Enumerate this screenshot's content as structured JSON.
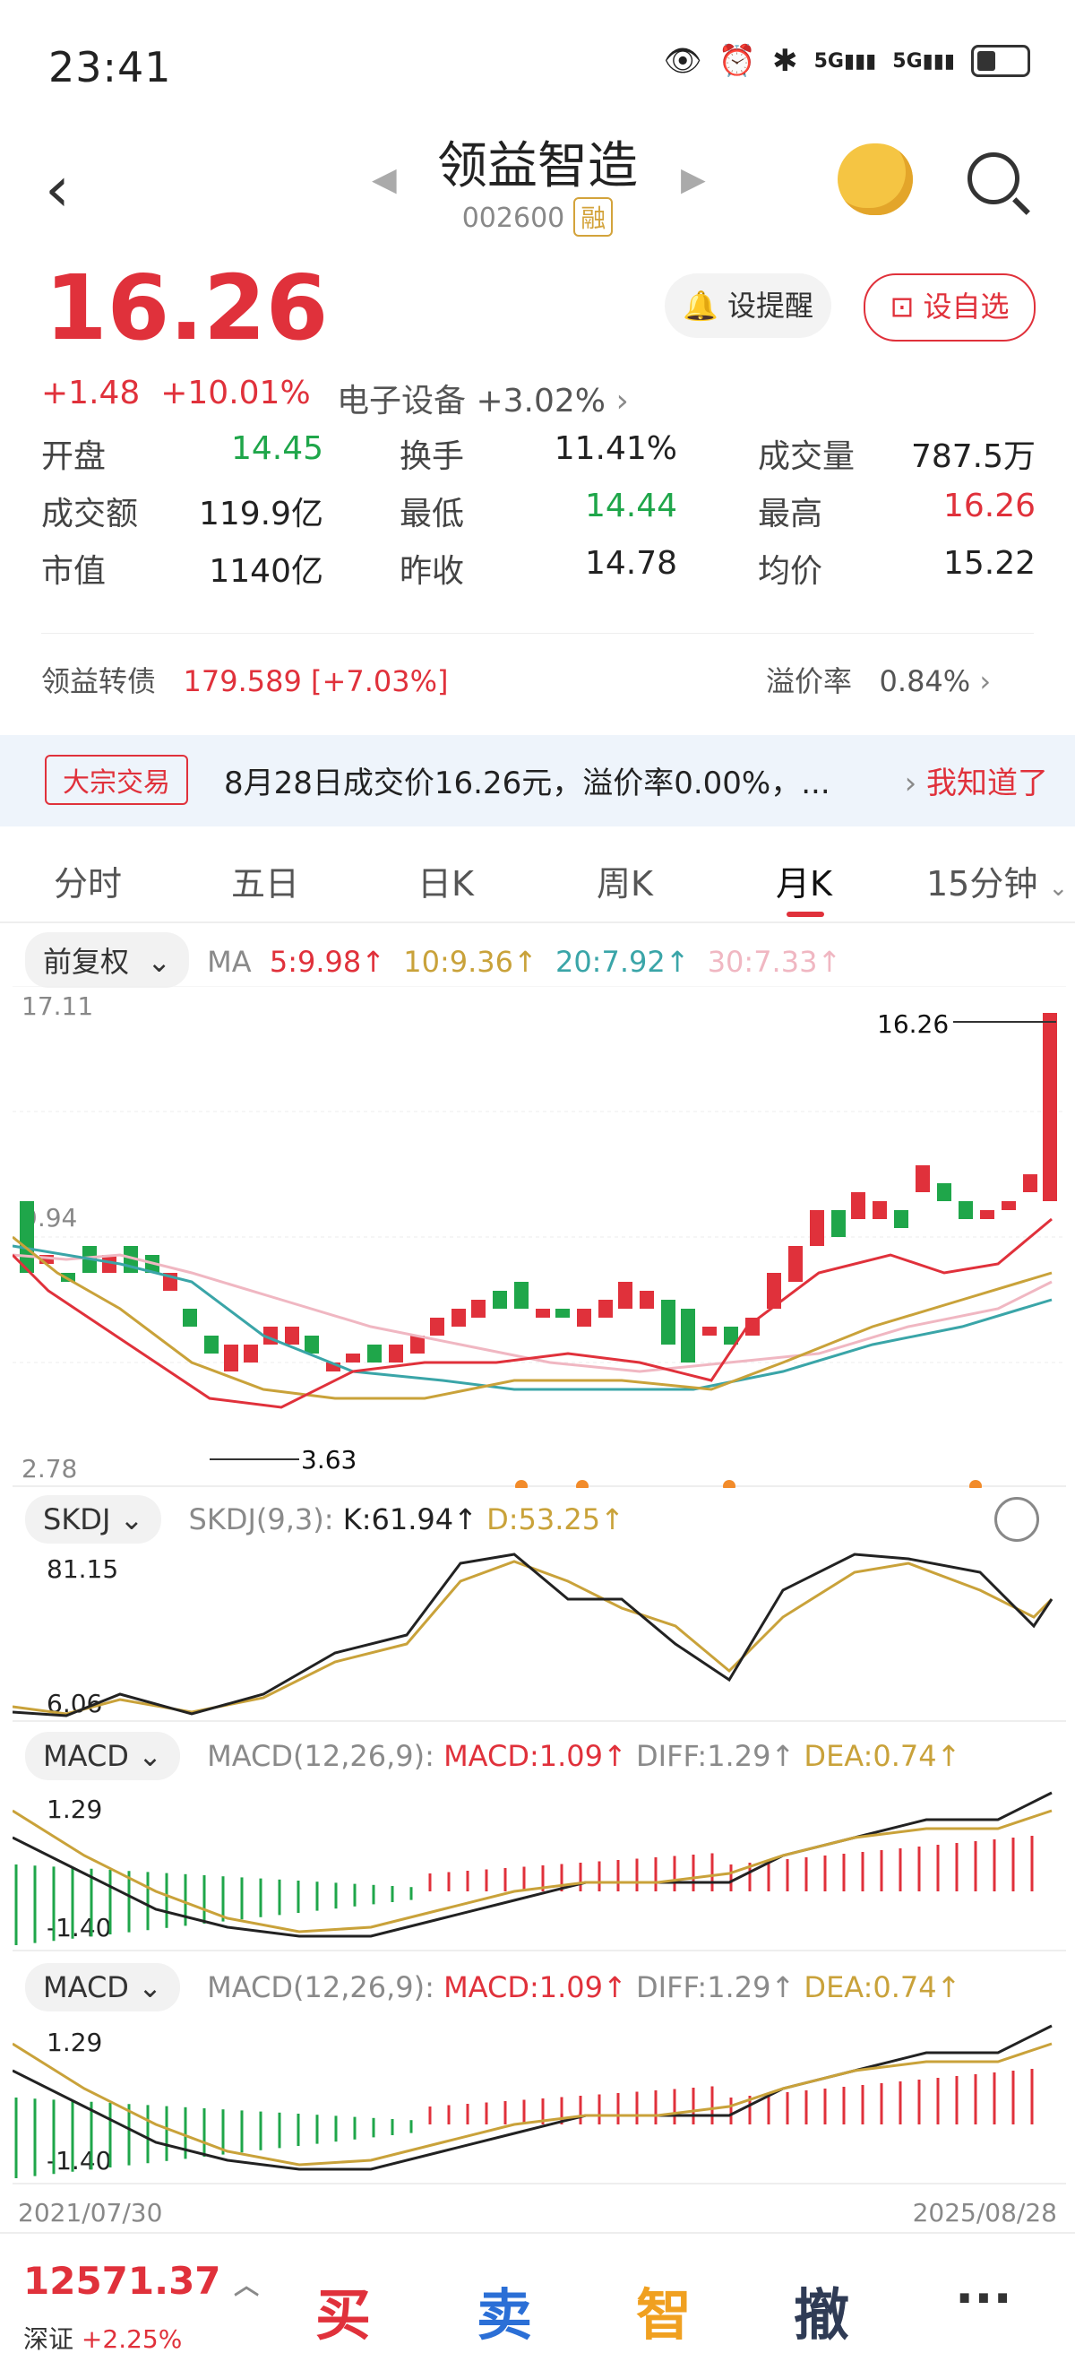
{
  "status_bar": {
    "time": "23:41",
    "network": [
      "5G",
      "5G"
    ]
  },
  "header": {
    "title": "领益智造",
    "code": "002600",
    "margin_badge": "融"
  },
  "quote": {
    "price": "16.26",
    "change": "+1.48",
    "change_pct": "+10.01%",
    "sector": "电子设备 +3.02%",
    "alert_label": "设提醒",
    "watch_label": "设自选"
  },
  "stats": [
    [
      {
        "label": "开盘",
        "value": "14.45",
        "color": "green"
      },
      {
        "label": "换手",
        "value": "11.41%",
        "color": "dark"
      },
      {
        "label": "成交量",
        "value": "787.5万",
        "color": "dark"
      }
    ],
    [
      {
        "label": "成交额",
        "value": "119.9亿",
        "color": "dark"
      },
      {
        "label": "最低",
        "value": "14.44",
        "color": "green"
      },
      {
        "label": "最高",
        "value": "16.26",
        "color": "red"
      }
    ],
    [
      {
        "label": "市值",
        "value": "1140亿",
        "color": "dark"
      },
      {
        "label": "昨收",
        "value": "14.78",
        "color": "dark"
      },
      {
        "label": "均价",
        "value": "15.22",
        "color": "dark"
      }
    ]
  ],
  "bond": {
    "name": "领益转债",
    "price": "179.589",
    "pct": "[+7.03%]",
    "premium_label": "溢价率",
    "premium_value": "0.84%"
  },
  "block_trade": {
    "tag": "大宗交易",
    "message": "8月28日成交价16.26元，溢价率0.00%，...",
    "dismiss": "我知道了"
  },
  "tabs": [
    "分时",
    "五日",
    "日K",
    "周K",
    "月K",
    "15分钟"
  ],
  "active_tab": "月K",
  "ma": {
    "mode": "前复权",
    "label": "MA",
    "ma5": "5:9.98↑",
    "ma10": "10:9.36↑",
    "ma20": "20:7.92↑",
    "ma30": "30:7.33↑"
  },
  "chart_labels": {
    "ymax": "17.11",
    "ymid": "9.94",
    "ymin": "2.78",
    "high_mark": "16.26",
    "low_mark": "3.63",
    "date_start": "2021/07/30",
    "date_end": "2025/08/28"
  },
  "skdj": {
    "label": "SKDJ",
    "params": "SKDJ(9,3):",
    "k": "K:61.94↑",
    "d": "D:53.25↑",
    "top": "81.15",
    "bottom": "6.06"
  },
  "macd": {
    "label": "MACD",
    "params": "MACD(12,26,9):",
    "macd": "MACD:1.09↑",
    "diff": "DIFF:1.29↑",
    "dea": "DEA:0.74↑",
    "top": "1.29",
    "bottom": "-1.40"
  },
  "bottom_bar": {
    "index_value": "12571.37",
    "index_name": "深证",
    "index_change": "+2.25%",
    "buy": "买",
    "sell": "卖",
    "smart": "智",
    "cancel": "撤",
    "more": "···"
  },
  "colors": {
    "up": "#e0313b",
    "down": "#1fa64a",
    "ma5": "#333333",
    "ma10": "#c9a23a",
    "ma20": "#3aa5a8",
    "ma30": "#f0b7c2"
  }
}
